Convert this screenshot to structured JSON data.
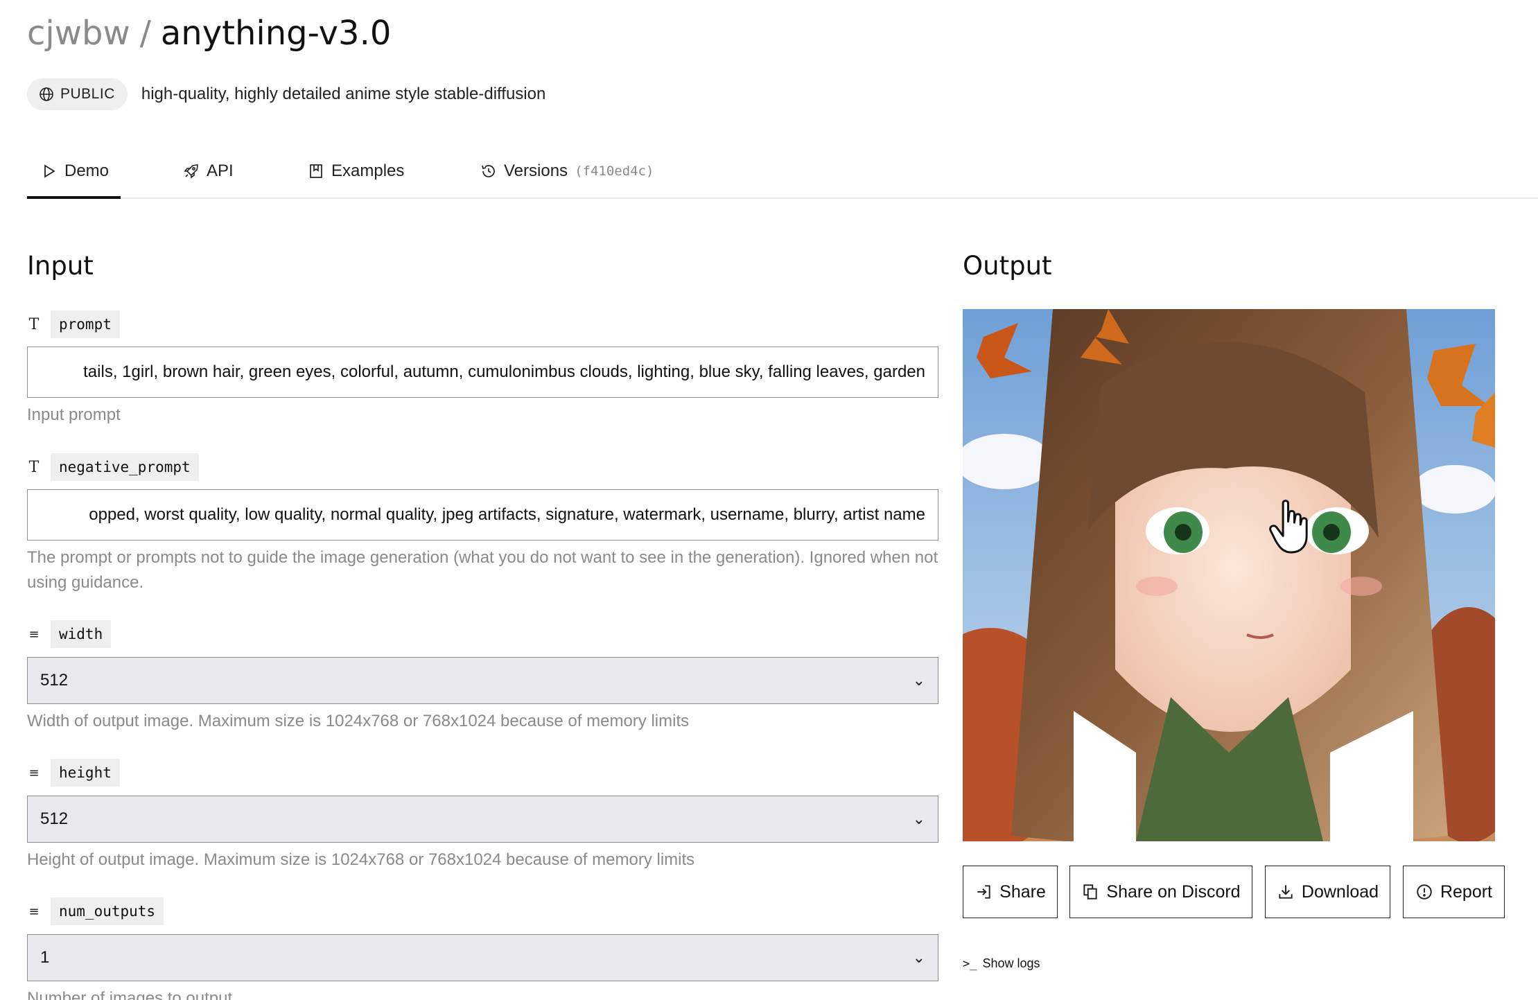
{
  "header": {
    "owner": "cjwbw",
    "separator": "/",
    "model": "anything-v3.0",
    "visibility": "PUBLIC",
    "description": "high-quality, highly detailed anime style stable-diffusion"
  },
  "tabs": [
    {
      "label": "Demo",
      "icon": "play-icon",
      "active": true
    },
    {
      "label": "API",
      "icon": "rocket-icon"
    },
    {
      "label": "Examples",
      "icon": "bookmark-icon"
    },
    {
      "label": "Versions",
      "icon": "history-icon",
      "hash": "(f410ed4c)"
    }
  ],
  "input": {
    "title": "Input",
    "fields": {
      "prompt": {
        "name": "prompt",
        "type_icon": "T",
        "value": "tails, 1girl, brown hair, green eyes, colorful, autumn, cumulonimbus clouds, lighting, blue sky, falling leaves, garden",
        "help": "Input prompt"
      },
      "negative_prompt": {
        "name": "negative_prompt",
        "type_icon": "T",
        "value": "opped, worst quality, low quality, normal quality, jpeg artifacts, signature, watermark, username, blurry, artist name",
        "help": "The prompt or prompts not to guide the image generation (what you do not want to see in the generation). Ignored when not using guidance."
      },
      "width": {
        "name": "width",
        "type_icon": "≡",
        "value": "512",
        "help": "Width of output image. Maximum size is 1024x768 or 768x1024 because of memory limits"
      },
      "height": {
        "name": "height",
        "type_icon": "≡",
        "value": "512",
        "help": "Height of output image. Maximum size is 1024x768 or 768x1024 because of memory limits"
      },
      "num_outputs": {
        "name": "num_outputs",
        "type_icon": "≡",
        "value": "1",
        "help": "Number of images to output"
      }
    }
  },
  "output": {
    "title": "Output",
    "buttons": {
      "share": "Share",
      "discord": "Share on Discord",
      "download": "Download",
      "report": "Report"
    },
    "show_logs": "Show logs",
    "show_logs_glyph": ">_"
  },
  "colors": {
    "muted_text": "#8a8a8a",
    "chip_bg": "#efefef",
    "select_bg": "#e9e9ed",
    "border": "#8f8f8f"
  }
}
